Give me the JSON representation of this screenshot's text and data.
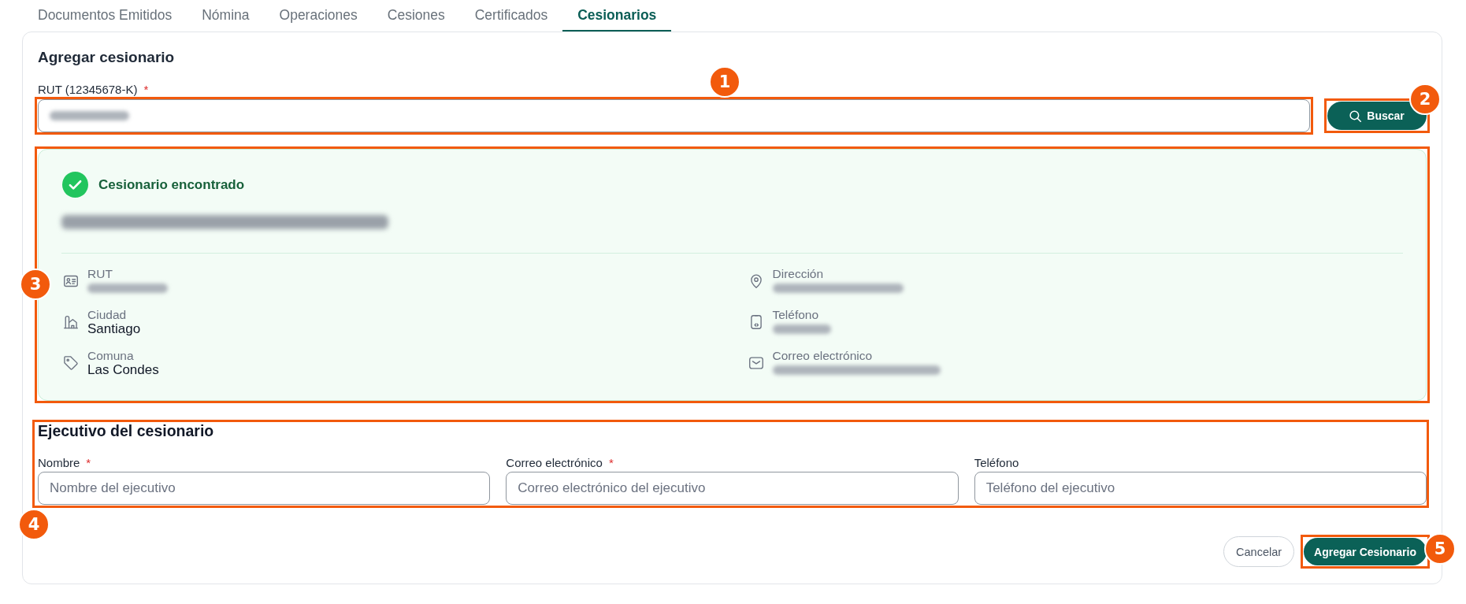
{
  "tabs": [
    {
      "label": "Documentos Emitidos",
      "selected": false
    },
    {
      "label": "Nómina",
      "selected": false
    },
    {
      "label": "Operaciones",
      "selected": false
    },
    {
      "label": "Cesiones",
      "selected": false
    },
    {
      "label": "Certificados",
      "selected": false
    },
    {
      "label": "Cesionarios",
      "selected": true
    }
  ],
  "form": {
    "title": "Agregar cesionario",
    "rut_field": {
      "label": "RUT (12345678-K)",
      "required_mark": "*",
      "value_redacted": true,
      "callout": "1"
    },
    "search_button": {
      "label": "Buscar",
      "callout": "2"
    },
    "result": {
      "found": true,
      "message": "Cesionario encontrado",
      "name_redacted": true,
      "callout": "3",
      "details": [
        {
          "label": "RUT",
          "redacted": true
        },
        {
          "label": "Dirección",
          "redacted": true
        },
        {
          "label": "Ciudad",
          "value": "Santiago",
          "redacted": false
        },
        {
          "label": "Teléfono",
          "redacted": true
        },
        {
          "label": "Comuna",
          "value": "Las Condes",
          "redacted": false
        },
        {
          "label": "Correo electrónico",
          "redacted": true
        }
      ]
    },
    "executive": {
      "title": "Ejecutivo del cesionario",
      "callout": "4",
      "fields": [
        {
          "label": "Nombre",
          "required_mark": "*",
          "placeholder": "Nombre del ejecutivo"
        },
        {
          "label": "Correo electrónico",
          "required_mark": "*",
          "placeholder": "Correo electrónico del ejecutivo"
        },
        {
          "label": "Teléfono",
          "placeholder": "Teléfono del ejecutivo"
        }
      ]
    },
    "actions": [
      {
        "label": "Cancelar",
        "kind": "secondary"
      },
      {
        "label": "Agregar Cesionario",
        "kind": "primary",
        "callout": "5"
      }
    ]
  }
}
